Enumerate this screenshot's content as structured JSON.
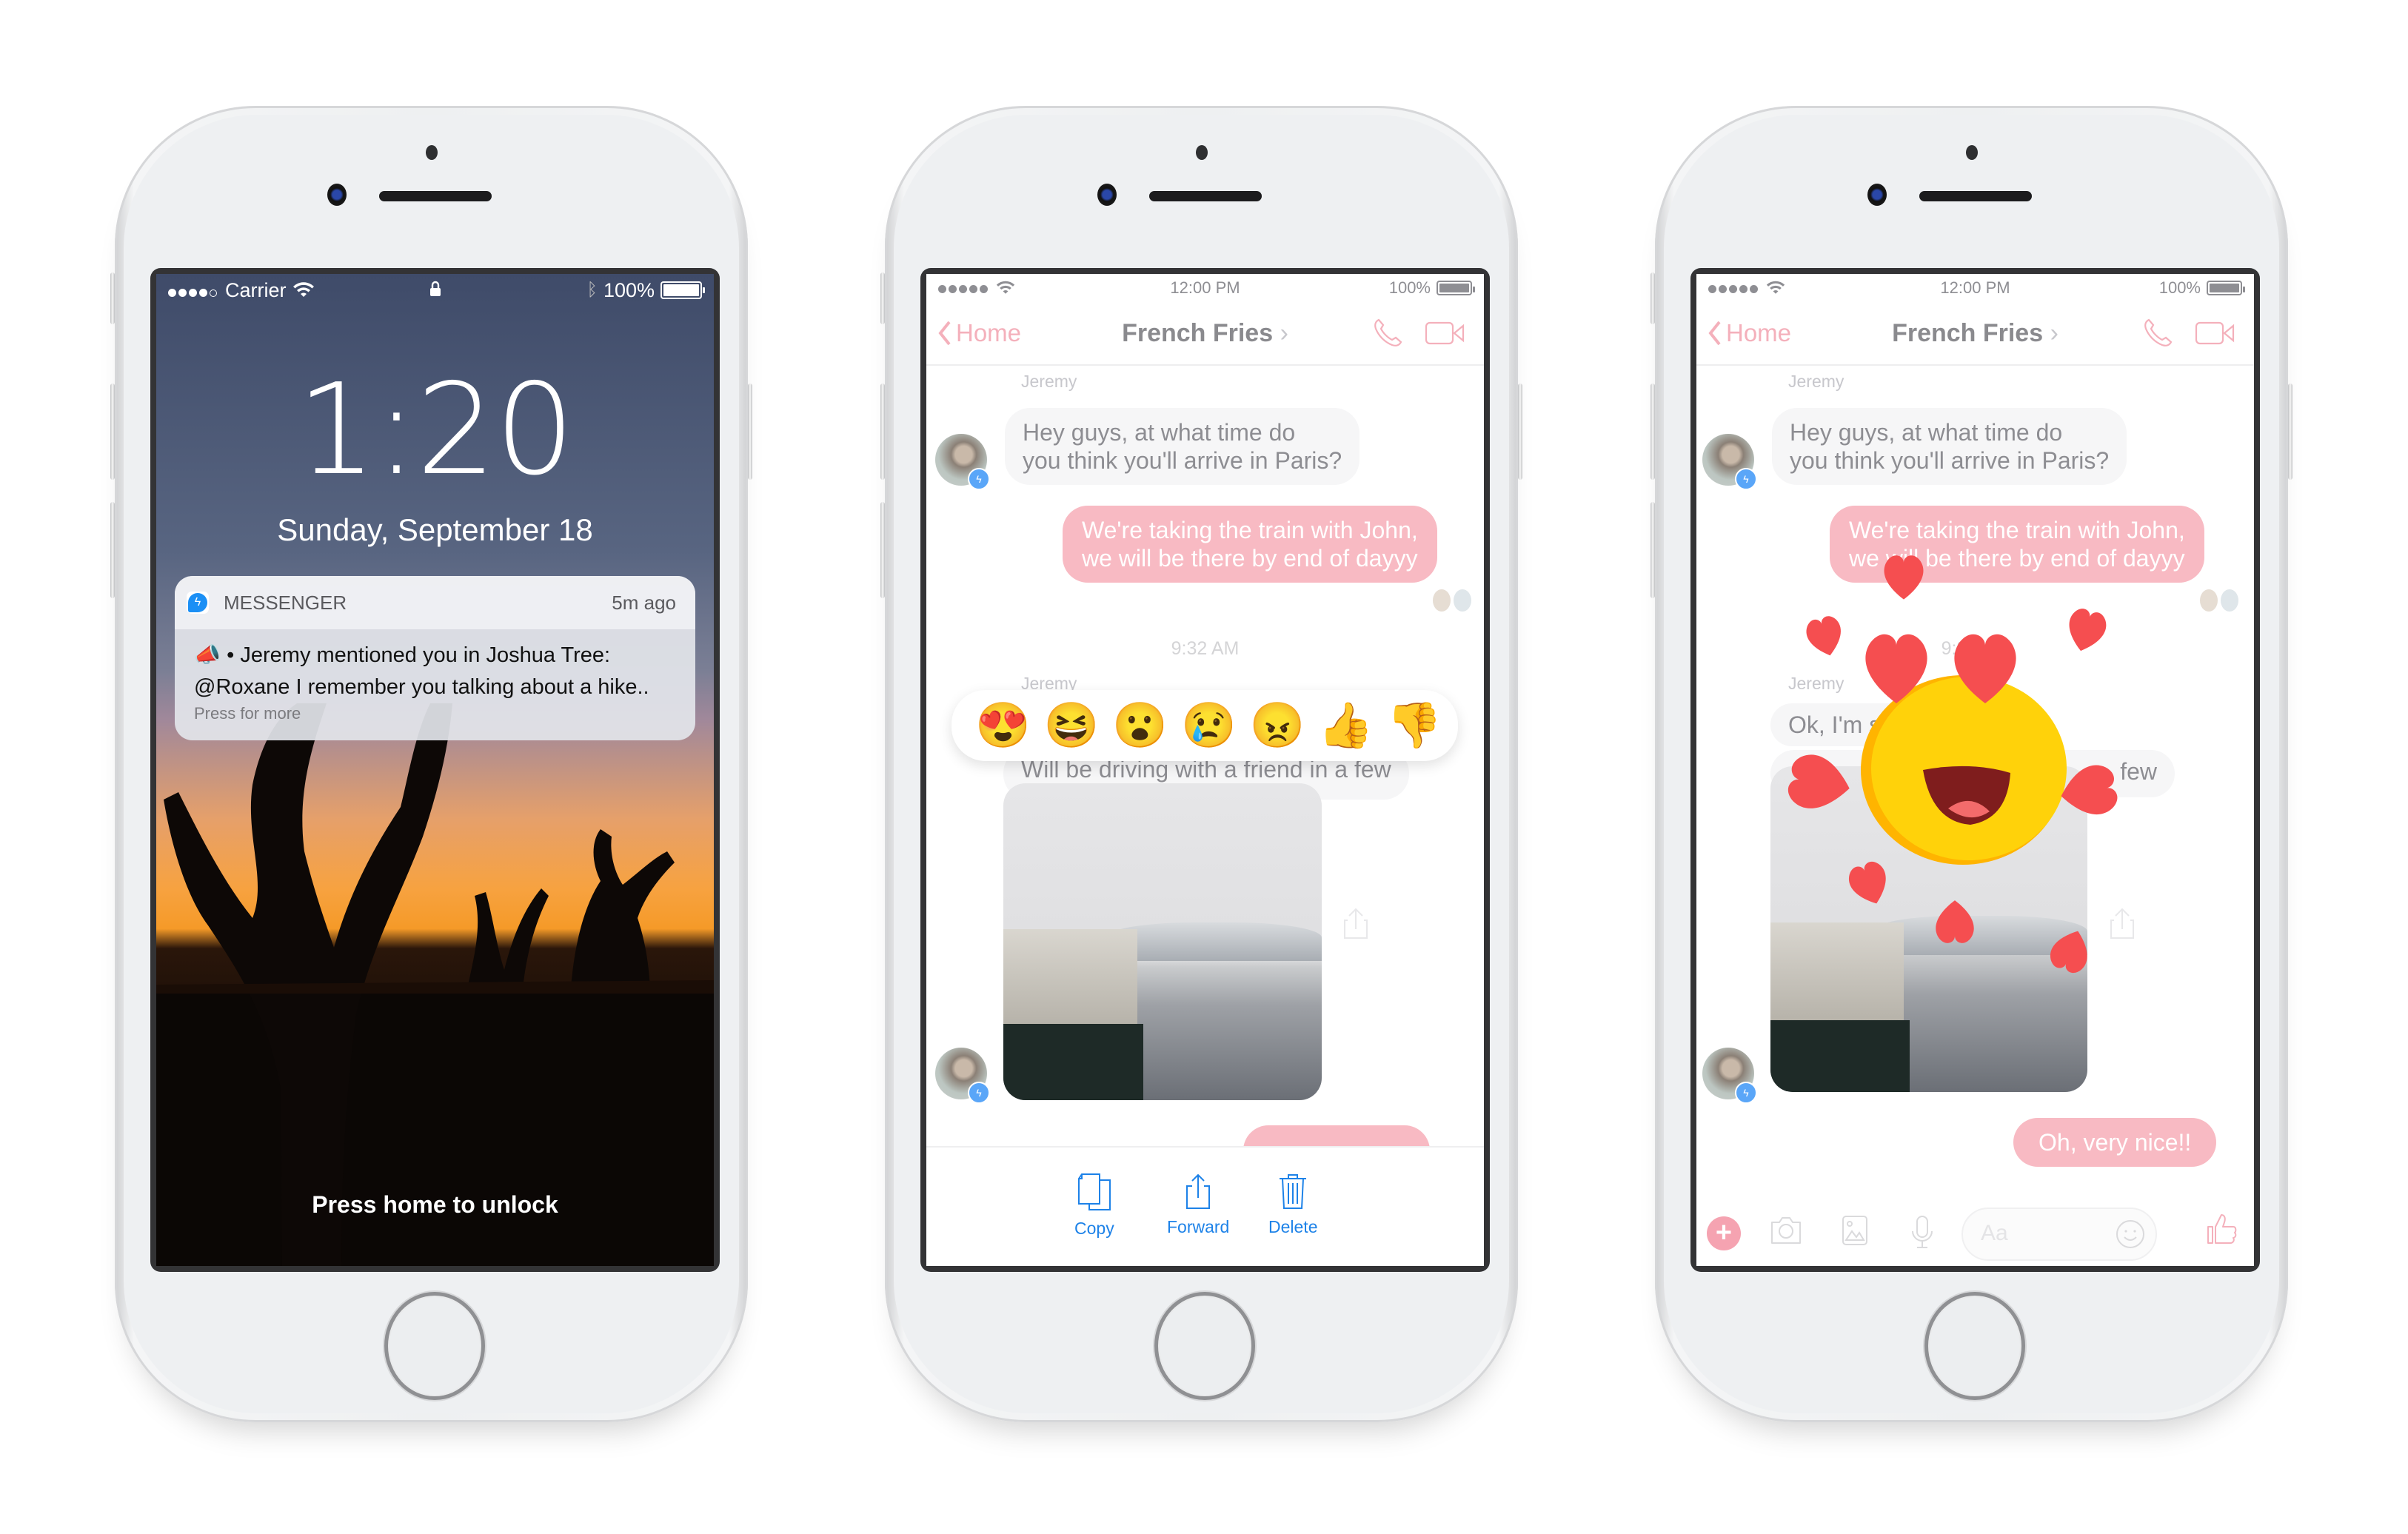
{
  "phones": {
    "lock_screen": {
      "status_bar": {
        "signal_dots": 5,
        "signal_filled": 4,
        "carrier": "Carrier",
        "battery": "100%",
        "battery_level": 1.0
      },
      "clock": "1:20",
      "date": "Sunday, September 18",
      "notification": {
        "app": "MESSENGER",
        "time": "5m ago",
        "line1": "• Jeremy mentioned you in Joshua Tree:",
        "line2": "@Roxane I remember you talking about a hike..",
        "hint": "Press for more"
      },
      "unlock_hint": "Press home to unlock"
    },
    "chat_reactions": {
      "status_bar": {
        "time": "12:00 PM",
        "battery": "100%",
        "battery_level": 1.0
      },
      "nav": {
        "back_label": "Home",
        "title": "French Fries",
        "title_chevron": "›"
      },
      "messages": {
        "sender1": "Jeremy",
        "incoming1": [
          "Hey guys, at what time do",
          "you think you'll arrive in Paris?"
        ],
        "outgoing1": [
          "We're taking the train with John,",
          "we will be there by end of dayyy"
        ],
        "timestamp": "9:32 AM",
        "sender2": "Jeremy",
        "incoming2": "Will be driving with a friend in a few"
      },
      "reactions": [
        {
          "name": "love",
          "glyph": "😍"
        },
        {
          "name": "laugh",
          "glyph": "😆"
        },
        {
          "name": "wow",
          "glyph": "😮"
        },
        {
          "name": "sad",
          "glyph": "😢"
        },
        {
          "name": "angry",
          "glyph": "😠"
        },
        {
          "name": "thumbs-up",
          "glyph": "👍"
        },
        {
          "name": "thumbs-down",
          "glyph": "👎"
        }
      ],
      "actions": [
        {
          "label": "Copy",
          "icon": "copy-icon"
        },
        {
          "label": "Forward",
          "icon": "share-icon"
        },
        {
          "label": "Delete",
          "icon": "trash-icon"
        }
      ]
    },
    "chat_animation": {
      "status_bar": {
        "time": "12:00 PM",
        "battery": "100%",
        "battery_level": 1.0
      },
      "nav": {
        "back_label": "Home",
        "title": "French Fries",
        "title_chevron": "›"
      },
      "messages": {
        "sender1": "Jeremy",
        "incoming1": [
          "Hey guys, at what time do",
          "you think you'll arrive in Paris?"
        ],
        "outgoing1": [
          "We're taking the train with John,",
          "we will be there by end of dayyy"
        ],
        "timestamp": "9:32 AM",
        "sender2": "Jeremy",
        "incoming2a": "Ok, I'm s",
        "incoming2b": "few",
        "outgoing2": "Oh, very nice!!"
      },
      "composer": {
        "placeholder": "Aa"
      },
      "animation": {
        "emoji": "love",
        "glyph": "😍"
      }
    }
  },
  "colors": {
    "accent_pink": "#f8bac3",
    "action_blue": "#1d82e8",
    "messenger_blue": "#1b8ff5",
    "heart_red": "#f54e50",
    "emoji_yellow": "#ffd20a"
  }
}
